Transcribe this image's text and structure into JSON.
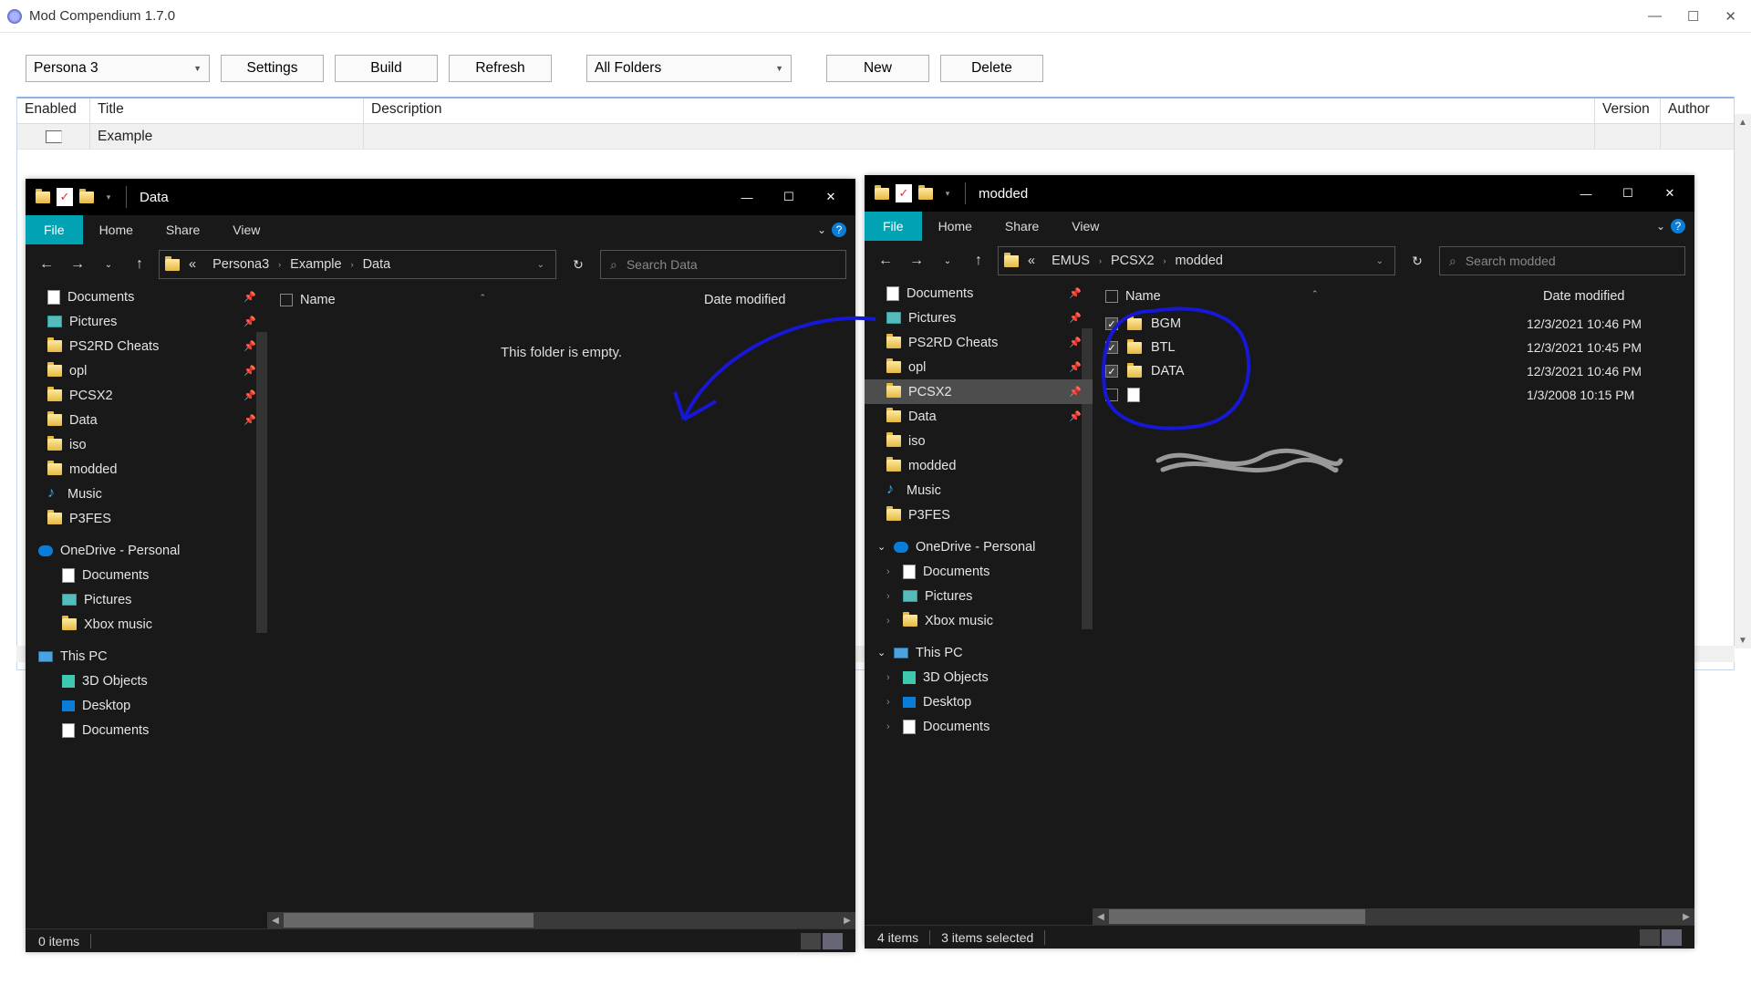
{
  "app": {
    "title": "Mod Compendium 1.7.0",
    "toolbar": {
      "game_dropdown": "Persona 3",
      "settings": "Settings",
      "build": "Build",
      "refresh": "Refresh",
      "folder_dropdown": "All Folders",
      "new": "New",
      "delete": "Delete"
    },
    "columns": {
      "enabled": "Enabled",
      "title": "Title",
      "description": "Description",
      "version": "Version",
      "author": "Author"
    },
    "row": {
      "title": "Example"
    }
  },
  "explorer_left": {
    "title": "Data",
    "ribbon": {
      "file": "File",
      "home": "Home",
      "share": "Share",
      "view": "View"
    },
    "breadcrumb": [
      "Persona3",
      "Example",
      "Data"
    ],
    "breadcrumb_prefix": "«",
    "search_placeholder": "Search Data",
    "col_name": "Name",
    "col_date": "Date modified",
    "empty": "This folder is empty.",
    "status": "0 items",
    "sidebar": [
      {
        "icon": "doc",
        "label": "Documents",
        "pin": true
      },
      {
        "icon": "pic",
        "label": "Pictures",
        "pin": true
      },
      {
        "icon": "folder",
        "label": "PS2RD Cheats",
        "pin": true
      },
      {
        "icon": "folder",
        "label": "opl",
        "pin": true
      },
      {
        "icon": "folder",
        "label": "PCSX2",
        "pin": true
      },
      {
        "icon": "folder",
        "label": "Data",
        "pin": true
      },
      {
        "icon": "folder",
        "label": "iso"
      },
      {
        "icon": "folder",
        "label": "modded"
      },
      {
        "icon": "music",
        "label": "Music"
      },
      {
        "icon": "folder",
        "label": "P3FES"
      }
    ],
    "onedrive_label": "OneDrive - Personal",
    "onedrive_items": [
      {
        "icon": "doc",
        "label": "Documents"
      },
      {
        "icon": "pic",
        "label": "Pictures"
      },
      {
        "icon": "folder",
        "label": "Xbox music"
      }
    ],
    "thispc_label": "This PC",
    "thispc_items": [
      {
        "icon": "cube",
        "label": "3D Objects"
      },
      {
        "icon": "desk",
        "label": "Desktop"
      },
      {
        "icon": "doc",
        "label": "Documents"
      }
    ]
  },
  "explorer_right": {
    "title": "modded",
    "ribbon": {
      "file": "File",
      "home": "Home",
      "share": "Share",
      "view": "View"
    },
    "breadcrumb": [
      "EMUS",
      "PCSX2",
      "modded"
    ],
    "breadcrumb_prefix": "«",
    "search_placeholder": "Search modded",
    "col_name": "Name",
    "col_date": "Date modified",
    "status_items": "4 items",
    "status_selected": "3 items selected",
    "files": [
      {
        "checked": true,
        "name": "BGM",
        "date": "12/3/2021 10:46 PM"
      },
      {
        "checked": true,
        "name": "BTL",
        "date": "12/3/2021 10:45 PM"
      },
      {
        "checked": true,
        "name": "DATA",
        "date": "12/3/2021 10:46 PM"
      },
      {
        "checked": false,
        "name": "",
        "date": "1/3/2008 10:15 PM",
        "scribbled": true
      }
    ],
    "sidebar": [
      {
        "icon": "doc",
        "label": "Documents",
        "pin": true
      },
      {
        "icon": "pic",
        "label": "Pictures",
        "pin": true
      },
      {
        "icon": "folder",
        "label": "PS2RD Cheats",
        "pin": true
      },
      {
        "icon": "folder",
        "label": "opl",
        "pin": true
      },
      {
        "icon": "folder",
        "label": "PCSX2",
        "pin": true,
        "selected": true
      },
      {
        "icon": "folder",
        "label": "Data",
        "pin": true
      },
      {
        "icon": "folder",
        "label": "iso"
      },
      {
        "icon": "folder",
        "label": "modded"
      },
      {
        "icon": "music",
        "label": "Music"
      },
      {
        "icon": "folder",
        "label": "P3FES"
      }
    ],
    "onedrive_label": "OneDrive - Personal",
    "onedrive_items": [
      {
        "icon": "doc",
        "label": "Documents"
      },
      {
        "icon": "pic",
        "label": "Pictures"
      },
      {
        "icon": "folder",
        "label": "Xbox music"
      }
    ],
    "thispc_label": "This PC",
    "thispc_items": [
      {
        "icon": "cube",
        "label": "3D Objects"
      },
      {
        "icon": "desk",
        "label": "Desktop"
      },
      {
        "icon": "doc",
        "label": "Documents"
      }
    ]
  }
}
